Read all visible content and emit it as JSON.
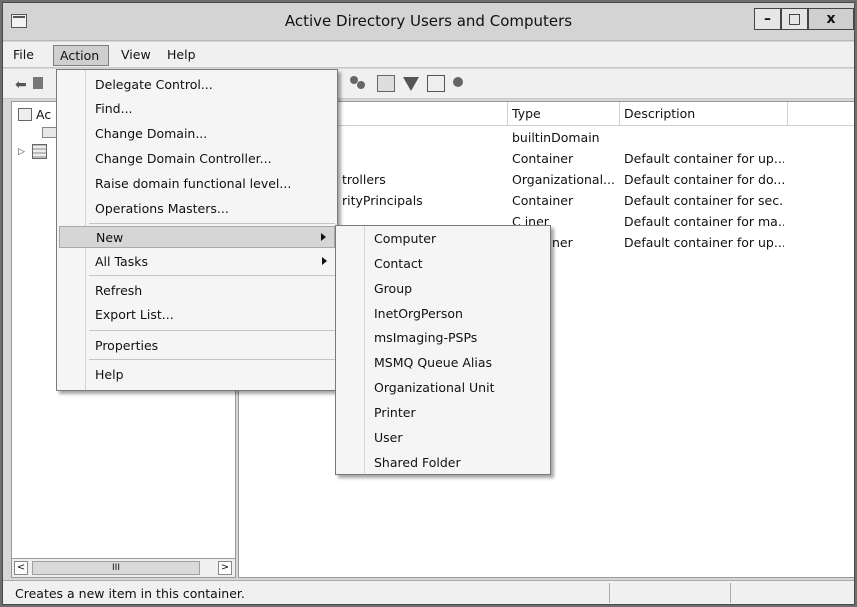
{
  "window": {
    "title": "Active Directory Users and Computers"
  },
  "window_controls": {
    "minimize": "–",
    "maximize": "□",
    "close": "x"
  },
  "menubar": {
    "file": "File",
    "action": "Action",
    "view": "View",
    "help": "Help"
  },
  "tree": {
    "root_label": "Ac"
  },
  "list": {
    "columns": {
      "type": "Type",
      "description": "Description"
    },
    "rows": [
      {
        "name": "",
        "type": "builtinDomain",
        "description": ""
      },
      {
        "name": "",
        "type": "Container",
        "description": "Default container for up..."
      },
      {
        "name": "trollers",
        "type": "Organizational...",
        "description": "Default container for do..."
      },
      {
        "name": "rityPrincipals",
        "type": "Container",
        "description": "Default container for sec..."
      },
      {
        "name": "",
        "type": "",
        "description": "Default container for ma..."
      },
      {
        "name": "",
        "type": "",
        "description": "Default container for up..."
      }
    ],
    "partial_row4_type": "C    iner",
    "partial_row5_type": "ner"
  },
  "scrollbar": {
    "left": "<",
    "thumb": "III",
    "right": ">"
  },
  "action_menu": {
    "items": [
      "Delegate Control...",
      "Find...",
      "Change Domain...",
      "Change Domain Controller...",
      "Raise domain functional level...",
      "Operations Masters...",
      "New",
      "All Tasks",
      "Refresh",
      "Export List...",
      "Properties",
      "Help"
    ],
    "highlighted": "New"
  },
  "new_menu": {
    "items": [
      "Computer",
      "Contact",
      "Group",
      "InetOrgPerson",
      "msImaging-PSPs",
      "MSMQ Queue Alias",
      "Organizational Unit",
      "Printer",
      "User",
      "Shared Folder"
    ]
  },
  "statusbar": {
    "text": "Creates a new item in this container."
  },
  "icons": [
    "back-arrow-icon",
    "forward-arrow-icon",
    "find-users-icon",
    "add-to-group-icon",
    "filter-icon",
    "query-icon",
    "delegate-icon",
    "app-icon",
    "folder-icon",
    "domain-icon"
  ]
}
